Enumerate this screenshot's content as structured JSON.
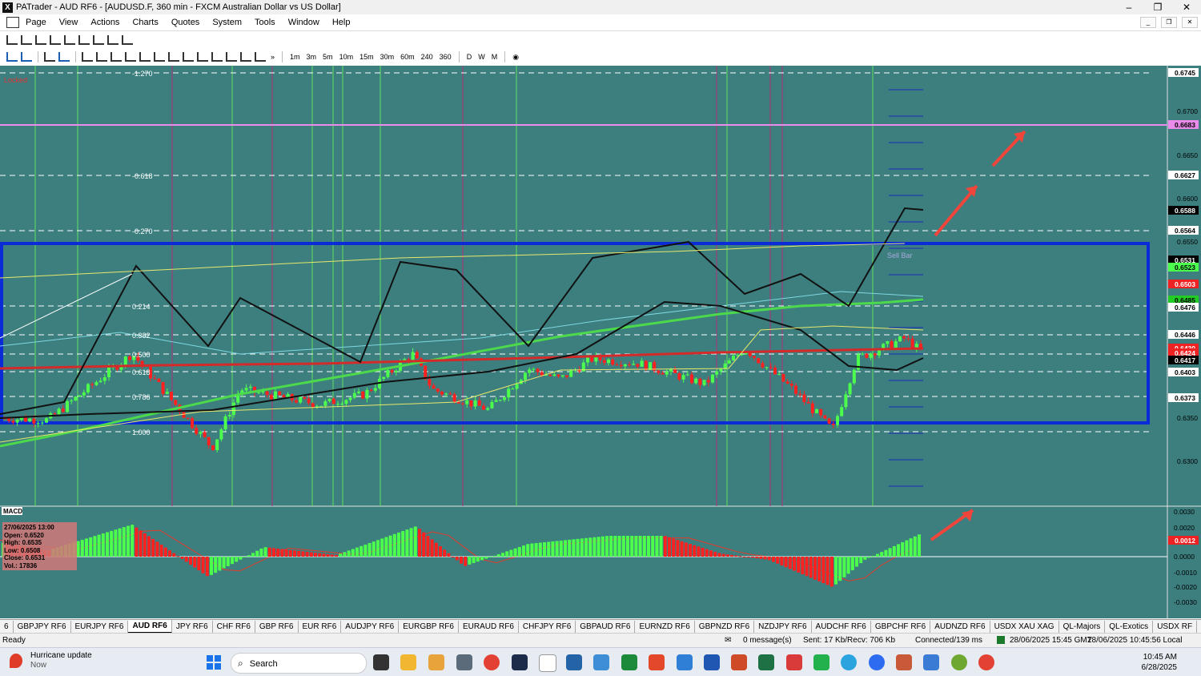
{
  "window": {
    "title": "PATrader - AUD RF6 - [AUDUSD.F, 360 min - FXCM Australian Dollar vs US Dollar]",
    "app_icon": "X",
    "buttons": [
      "–",
      "❐",
      "✕"
    ]
  },
  "menu": {
    "items": [
      "Page",
      "View",
      "Actions",
      "Charts",
      "Quotes",
      "System",
      "Tools",
      "Window",
      "Help"
    ]
  },
  "toolbar": {
    "timeframes": [
      "1m",
      "3m",
      "5m",
      "10m",
      "15m",
      "30m",
      "60m",
      "240",
      "360",
      "D",
      "W",
      "M"
    ],
    "more": "»"
  },
  "chart": {
    "locked_label": "Locked",
    "price_labels": [
      "0.6745",
      "0.6700",
      "0.6683",
      "0.6650",
      "0.6627",
      "0.6600",
      "0.6588",
      "0.6564",
      "0.6550",
      "0.6531",
      "0.6523",
      "0.6503",
      "0.6485",
      "0.6476",
      "0.6446",
      "0.6430",
      "0.6424",
      "0.6417",
      "0.6403",
      "0.6373",
      "0.6350",
      "0.6300"
    ],
    "fib_labels": [
      "-1.270",
      "-0.618",
      "-0.270",
      "0.214",
      "0.382",
      "0.500",
      "0.618",
      "0.786",
      "1.000"
    ],
    "box_label": "Sell Bar",
    "ohlc": {
      "date": "27/06/2025 13:00",
      "open": "Open: 0.6520",
      "high": "High: 0.6535",
      "low": "Low: 0.6508",
      "close": "Close: 0.6531",
      "vol": "Vol.: 17836"
    },
    "macd_label": "MACD",
    "macd_labels": [
      "0.0030",
      "0.0020",
      "0.0012",
      "0.0000",
      "-0.0010",
      "-0.0020",
      "-0.0030"
    ],
    "colors": {
      "background": "#3d7f7f",
      "box": "#0b2ad8",
      "up": "#4dff4d",
      "down": "#ff2020",
      "arrow": "#f0453a",
      "magenta": "#e98bea"
    }
  },
  "tabs": [
    "6",
    "GBPJPY RF6",
    "EURJPY RF6",
    "AUD RF6",
    "JPY RF6",
    "CHF RF6",
    "GBP RF6",
    "EUR RF6",
    "AUDJPY RF6",
    "EURGBP RF6",
    "EURAUD RF6",
    "CHFJPY RF6",
    "GBPAUD RF6",
    "EURNZD RF6",
    "GBPNZD RF6",
    "NZDJPY RF6",
    "AUDCHF RF6",
    "GBPCHF RF6",
    "AUDNZD RF6",
    "USDX XAU XAG",
    "QL-Majors",
    "QL-Exotics",
    "USDX RF",
    "Bitcoin",
    "Lyte",
    "SP500 RF6",
    "DJIA",
    "Ethirium"
  ],
  "status": {
    "ready": "Ready",
    "messages": "0 message(s)",
    "traffic": "Sent: 17 Kb/Recv: 706 Kb",
    "connection": "Connected/139 ms",
    "gmt": "28/06/2025 15:45 GMT",
    "local": "28/06/2025 10:45:56 Local"
  },
  "taskbar": {
    "notification_title": "Hurricane update",
    "notification_sub": "Now",
    "search_placeholder": "Search",
    "time": "10:45 AM",
    "date": "6/28/2025"
  }
}
